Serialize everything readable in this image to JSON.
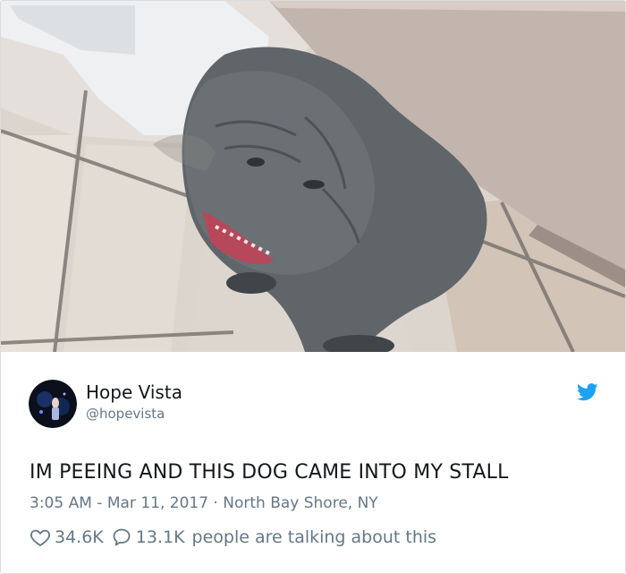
{
  "tweet": {
    "author_name": "Hope Vista",
    "author_handle": "@hopevista",
    "text": "IM PEEING AND THIS DOG CAME INTO MY STALL",
    "time": "3:05 AM",
    "date_separator": " - ",
    "date": "Mar 11, 2017",
    "location_separator": " · ",
    "location": "North Bay Shore, NY",
    "likes": "34.6K",
    "replies": "13.1K",
    "talking_text": "people are talking about this"
  },
  "icons": {
    "platform": "twitter-bird-icon",
    "like": "heart-icon",
    "reply": "speech-bubble-icon"
  },
  "colors": {
    "twitter_blue": "#1da1f2",
    "text_primary": "#14171a",
    "text_secondary": "#657786"
  }
}
